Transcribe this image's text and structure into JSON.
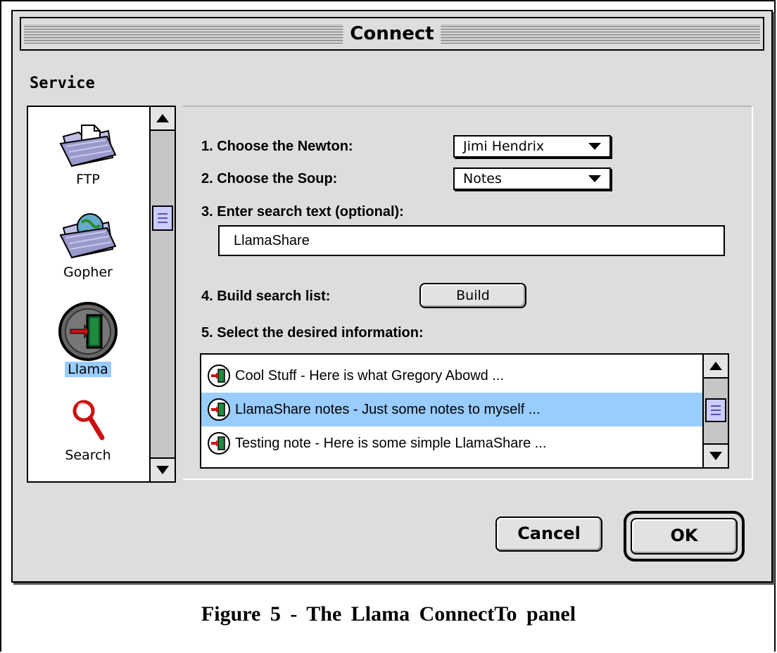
{
  "window": {
    "title": "Connect"
  },
  "service": {
    "label": "Service",
    "items": [
      {
        "label": "FTP",
        "icon": "ftp-folder-icon",
        "selected": false
      },
      {
        "label": "Gopher",
        "icon": "gopher-globe-folder-icon",
        "selected": false
      },
      {
        "label": "Llama",
        "icon": "llama-icon",
        "selected": true
      },
      {
        "label": "Search",
        "icon": "magnifier-icon",
        "selected": false
      }
    ]
  },
  "steps": {
    "newton_label": "1. Choose the Newton:",
    "newton_value": "Jimi Hendrix",
    "soup_label": "2. Choose the Soup:",
    "soup_value": "Notes",
    "search_label": "3. Enter search text (optional):",
    "search_value": "LlamaShare",
    "build_label": "4. Build search list:",
    "build_button": "Build",
    "select_label": "5. Select the desired information:"
  },
  "results": [
    {
      "text": "Cool Stuff - Here is what Gregory Abowd ...",
      "selected": false
    },
    {
      "text": "LlamaShare notes - Just some notes to myself ...",
      "selected": true
    },
    {
      "text": "Testing note - Here is some simple LlamaShare ...",
      "selected": false
    }
  ],
  "buttons": {
    "cancel": "Cancel",
    "ok": "OK"
  },
  "caption": "Figure 5 - The Llama ConnectTo panel",
  "colors": {
    "selection": "#99ccff",
    "thumb": "#ccccff",
    "window": "#dddddd"
  }
}
